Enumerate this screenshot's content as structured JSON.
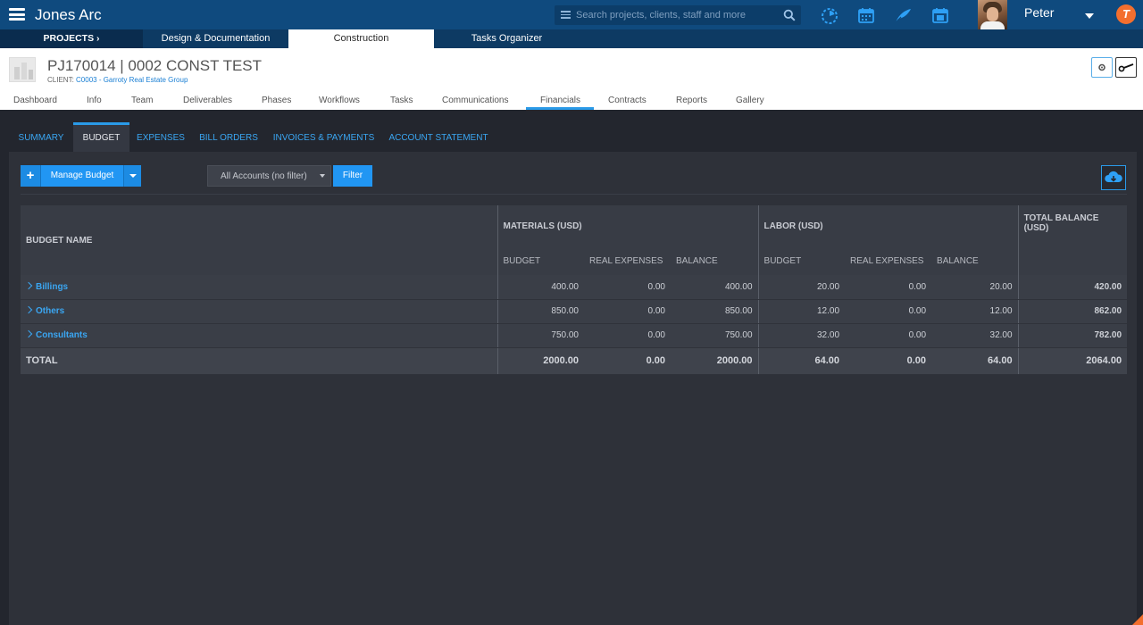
{
  "app": {
    "brand": "Jones Arc"
  },
  "search": {
    "placeholder": "Search projects, clients, staff and more"
  },
  "user": {
    "name": "Peter",
    "badge": "T"
  },
  "module_tabs": [
    "PROJECTS",
    "Design & Documentation",
    "Construction",
    "Tasks Organizer"
  ],
  "project": {
    "title": "PJ170014 | 0002 CONST TEST",
    "client_label": "CLIENT: ",
    "client_link": "C0003 - Garroty Real Estate Group"
  },
  "subnav": [
    "Dashboard",
    "Info",
    "Team",
    "Deliverables",
    "Phases",
    "Workflows",
    "Tasks",
    "Communications",
    "Financials",
    "Contracts",
    "Reports",
    "Gallery"
  ],
  "financial_tabs": [
    "SUMMARY",
    "BUDGET",
    "EXPENSES",
    "BILL ORDERS",
    "INVOICES & PAYMENTS",
    "ACCOUNT STATEMENT"
  ],
  "toolbar": {
    "manage_budget": "Manage Budget",
    "plus": "+",
    "account_filter": "All Accounts (no filter)",
    "filter": "Filter"
  },
  "table": {
    "col_name": "BUDGET NAME",
    "group_materials": "MATERIALS (USD)",
    "group_labor": "LABOR (USD)",
    "col_total_1": "TOTAL BALANCE",
    "col_total_2": "(USD)",
    "sub_budget": "BUDGET",
    "sub_real": "REAL EXPENSES",
    "sub_balance": "BALANCE",
    "rows": [
      {
        "name": "Billings",
        "m_budget": "400.00",
        "m_real": "0.00",
        "m_balance": "400.00",
        "l_budget": "20.00",
        "l_real": "0.00",
        "l_balance": "20.00",
        "total": "420.00"
      },
      {
        "name": "Others",
        "m_budget": "850.00",
        "m_real": "0.00",
        "m_balance": "850.00",
        "l_budget": "12.00",
        "l_real": "0.00",
        "l_balance": "12.00",
        "total": "862.00"
      },
      {
        "name": "Consultants",
        "m_budget": "750.00",
        "m_real": "0.00",
        "m_balance": "750.00",
        "l_budget": "32.00",
        "l_real": "0.00",
        "l_balance": "32.00",
        "total": "782.00"
      }
    ],
    "total_row": {
      "name": "TOTAL",
      "m_budget": "2000.00",
      "m_real": "0.00",
      "m_balance": "2000.00",
      "l_budget": "64.00",
      "l_real": "0.00",
      "l_balance": "64.00",
      "total": "2064.00"
    }
  },
  "icons": {
    "hamburger": "menu-icon",
    "search": "search-icon",
    "timer": "timer-icon",
    "calendar": "calendar-icon",
    "quill": "quill-icon",
    "calendar_day": "calendar-day-icon",
    "gear": "gear-icon",
    "key": "key-icon",
    "cloud": "cloud-download-icon"
  },
  "colors": {
    "topbar": "#0f4a7e",
    "accent": "#2196f3",
    "link": "#3aa6f2",
    "panel": "#2e3139",
    "brand_badge": "#f36f2e"
  }
}
